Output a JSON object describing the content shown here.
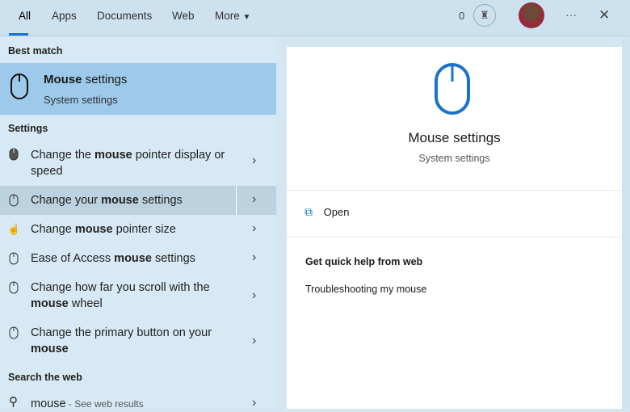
{
  "tabs": [
    "All",
    "Apps",
    "Documents",
    "Web",
    "More"
  ],
  "header": {
    "points": "0",
    "more_options": "···",
    "close": "✕"
  },
  "best_match": {
    "heading": "Best match",
    "title_bold": "Mouse",
    "title_rest": " settings",
    "subtitle": "System settings"
  },
  "settings": {
    "heading": "Settings",
    "items": [
      {
        "pre": "Change the ",
        "bold": "mouse",
        "post": " pointer display or speed"
      },
      {
        "pre": "Change your ",
        "bold": "mouse",
        "post": " settings"
      },
      {
        "pre": "Change ",
        "bold": "mouse",
        "post": " pointer size"
      },
      {
        "pre": "Ease of Access ",
        "bold": "mouse",
        "post": " settings"
      },
      {
        "pre": "Change how far you scroll with the ",
        "bold": "mouse",
        "post": " wheel"
      },
      {
        "pre": "Change the primary button on your ",
        "bold": "mouse",
        "post": ""
      }
    ]
  },
  "web": {
    "heading": "Search the web",
    "query": "mouse",
    "suffix": " - See web results"
  },
  "detail": {
    "title": "Mouse settings",
    "subtitle": "System settings",
    "open": "Open",
    "help_heading": "Get quick help from web",
    "help_link": "Troubleshooting my mouse"
  },
  "colors": {
    "accent": "#1a73c8",
    "selected": "#9dc9ea"
  }
}
